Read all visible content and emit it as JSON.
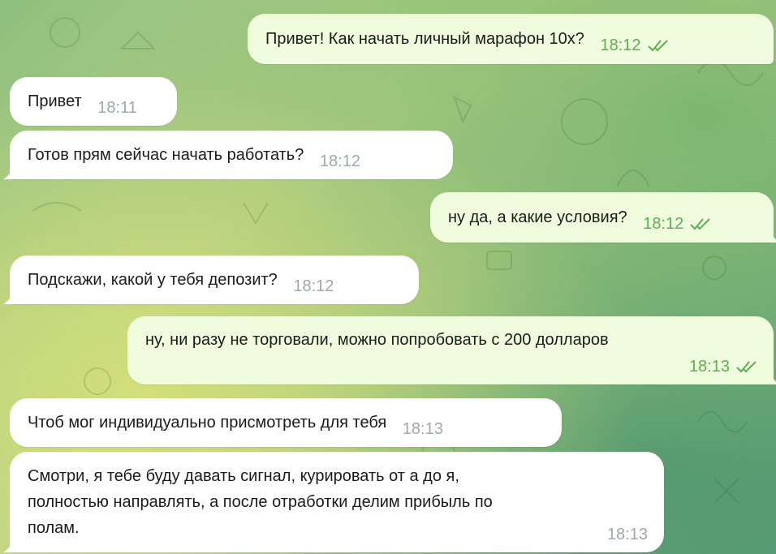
{
  "colors": {
    "incoming_bubble": "#ffffff",
    "outgoing_bubble": "#effdde",
    "incoming_time": "#a3a7ab",
    "outgoing_time": "#5fae50",
    "check_icon": "#5fae50"
  },
  "messages": [
    {
      "direction": "out",
      "text": "Привет! Как начать личный марафон 10х?",
      "time": "18:12",
      "status_icon": "double-check-icon"
    },
    {
      "direction": "in",
      "text": "Привет",
      "time": "18:11"
    },
    {
      "direction": "in",
      "text": "Готов прям сейчас начать работать?",
      "time": "18:12"
    },
    {
      "direction": "out",
      "text": "ну да, а какие условия?",
      "time": "18:12",
      "status_icon": "double-check-icon"
    },
    {
      "direction": "in",
      "text": "Подскажи, какой у тебя депозит?",
      "time": "18:12"
    },
    {
      "direction": "out",
      "text": "ну, ни разу не торговали, можно попробовать с 200 долларов",
      "time": "18:13",
      "status_icon": "double-check-icon"
    },
    {
      "direction": "in",
      "text": "Чтоб мог индивидуально присмотреть для тебя",
      "time": "18:13"
    },
    {
      "direction": "in",
      "lines": [
        "Смотри, я тебе буду давать сигнал, курировать от а до я,",
        "полностью направлять, а после отработки делим прибыль по",
        "полам."
      ],
      "time": "18:13"
    }
  ]
}
